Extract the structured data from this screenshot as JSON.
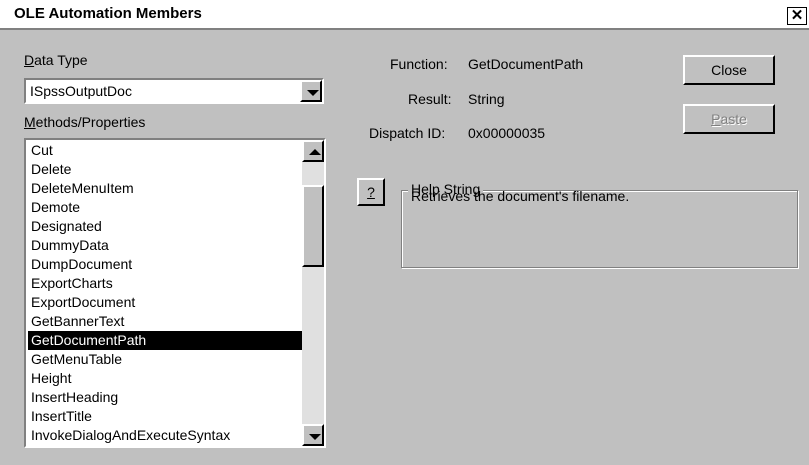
{
  "window": {
    "title": "OLE Automation Members",
    "close_glyph": "✕"
  },
  "data_type": {
    "label_accel": "D",
    "label_rest": "ata Type",
    "selected": "ISpssOutputDoc"
  },
  "methods": {
    "label_accel": "M",
    "label_rest": "ethods/Properties",
    "items": [
      "Cut",
      "Delete",
      "DeleteMenuItem",
      "Demote",
      "Designated",
      "DummyData",
      "DumpDocument",
      "ExportCharts",
      "ExportDocument",
      "GetBannerText",
      "GetDocumentPath",
      "GetMenuTable",
      "Height",
      "InsertHeading",
      "InsertTitle",
      "InvokeDialogAndExecuteSyntax"
    ],
    "selected_index": 10
  },
  "details": {
    "function_label": "Function:",
    "function_value": "GetDocumentPath",
    "result_label": "Result:",
    "result_value": "String",
    "dispatch_label": "Dispatch ID:",
    "dispatch_value": "0x00000035"
  },
  "buttons": {
    "close": "Close",
    "paste_accel": "P",
    "paste_rest": "aste",
    "help": "?"
  },
  "help": {
    "group_label": "Help String",
    "text": "Retrieves the document's filename."
  }
}
